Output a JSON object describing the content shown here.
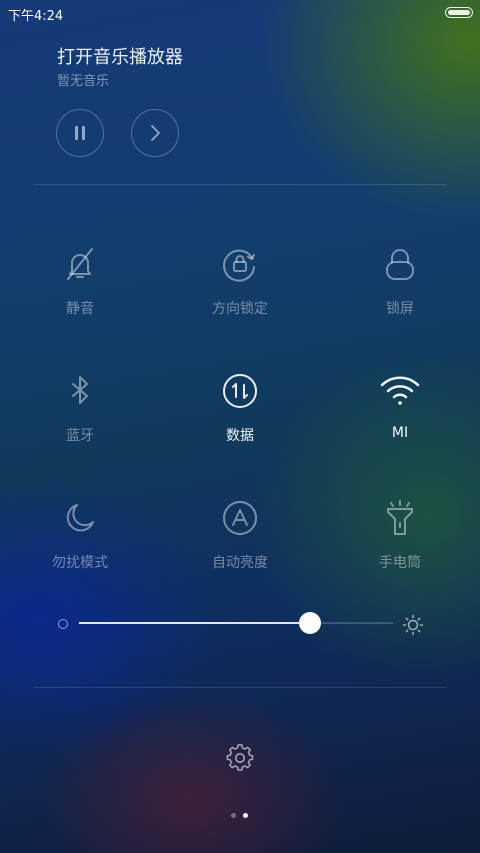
{
  "status_bar": {
    "time": "下午4:24"
  },
  "music": {
    "title": "打开音乐播放器",
    "subtitle": "暂无音乐"
  },
  "toggles": [
    {
      "label": "静音",
      "icon": "bell-off-icon",
      "on": false
    },
    {
      "label": "方向锁定",
      "icon": "rotation-lock-icon",
      "on": false
    },
    {
      "label": "锁屏",
      "icon": "lock-icon",
      "on": false
    },
    {
      "label": "蓝牙",
      "icon": "bluetooth-icon",
      "on": false
    },
    {
      "label": "数据",
      "icon": "mobile-data-icon",
      "on": true
    },
    {
      "label": "MI",
      "icon": "wifi-icon",
      "on": true
    },
    {
      "label": "勿扰模式",
      "icon": "moon-icon",
      "on": false
    },
    {
      "label": "自动亮度",
      "icon": "auto-brightness-icon",
      "on": false
    },
    {
      "label": "手电筒",
      "icon": "flashlight-icon",
      "on": false
    }
  ],
  "brightness": {
    "level": 0.735
  },
  "pager": {
    "count": 2,
    "active": 1
  }
}
